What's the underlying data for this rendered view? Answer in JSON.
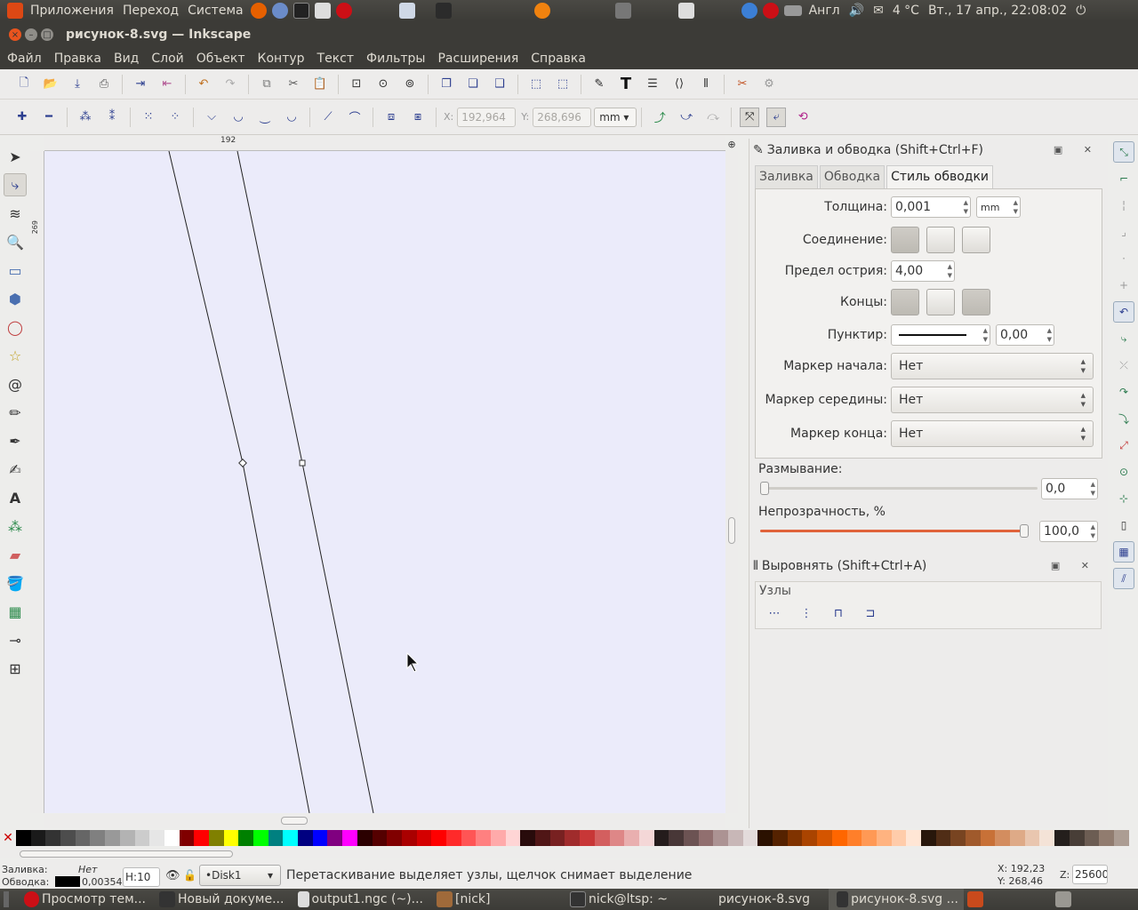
{
  "top_panel": {
    "menus": [
      "Приложения",
      "Переход",
      "Система"
    ],
    "layout": "Англ",
    "weather": "4 °C",
    "datetime": "Вт., 17 апр., 22:08:02"
  },
  "window": {
    "title": "рисунок-8.svg — Inkscape"
  },
  "menubar": [
    "Файл",
    "Правка",
    "Вид",
    "Слой",
    "Объект",
    "Контур",
    "Текст",
    "Фильтры",
    "Расширения",
    "Справка"
  ],
  "node_toolbar": {
    "x_label": "X:",
    "x_value": "192,964",
    "y_label": "Y:",
    "y_value": "268,696",
    "unit": "mm"
  },
  "ruler": {
    "h_label": "192",
    "v_label": "269"
  },
  "fill_stroke": {
    "title": "Заливка и обводка (Shift+Ctrl+F)",
    "tabs": [
      "Заливка",
      "Обводка",
      "Стиль обводки"
    ],
    "width_label": "Толщина:",
    "width_value": "0,001",
    "width_unit": "mm",
    "join_label": "Соединение:",
    "miter_label": "Предел острия:",
    "miter_value": "4,00",
    "cap_label": "Концы:",
    "dash_label": "Пунктир:",
    "dash_offset": "0,00",
    "start_marker_label": "Маркер начала:",
    "start_marker": "Нет",
    "mid_marker_label": "Маркер середины:",
    "mid_marker": "Нет",
    "end_marker_label": "Маркер конца:",
    "end_marker": "Нет",
    "blur_label": "Размывание:",
    "blur_value": "0,0",
    "opacity_label": "Непрозрачность, %",
    "opacity_value": "100,0",
    "blur_level": 0.0,
    "opacity_level": 1.0
  },
  "align": {
    "title": "Выровнять (Shift+Ctrl+A)",
    "section": "Узлы"
  },
  "palette": [
    "#000000",
    "#1a1a1a",
    "#333333",
    "#4d4d4d",
    "#666666",
    "#808080",
    "#999999",
    "#b3b3b3",
    "#cccccc",
    "#e6e6e6",
    "#ffffff",
    "#800000",
    "#ff0000",
    "#808000",
    "#ffff00",
    "#008000",
    "#00ff00",
    "#008080",
    "#00ffff",
    "#000080",
    "#0000ff",
    "#800080",
    "#ff00ff",
    "#2b0000",
    "#550000",
    "#800000",
    "#aa0000",
    "#d40000",
    "#ff0000",
    "#ff2a2a",
    "#ff5555",
    "#ff8080",
    "#ffaaaa",
    "#ffd5d5",
    "#280b0b",
    "#501616",
    "#782121",
    "#a02c2c",
    "#c83737",
    "#d35f5f",
    "#de8787",
    "#e9afaf",
    "#f4d7d7",
    "#241c1c",
    "#483737",
    "#6c5353",
    "#916f6f",
    "#ac9393",
    "#c8b7b7",
    "#e3dbdb",
    "#2b1100",
    "#552200",
    "#803300",
    "#aa4400",
    "#d45500",
    "#ff6600",
    "#ff7f2a",
    "#ff9955",
    "#ffb380",
    "#ffccaa",
    "#ffe6d5",
    "#28170b",
    "#502d16",
    "#784421",
    "#a05a2c",
    "#c87137",
    "#d38d5f",
    "#deaa87",
    "#e9c6af",
    "#f4e3d7",
    "#241f1c",
    "#483e37",
    "#6c5d53",
    "#917c6f",
    "#ac9d93"
  ],
  "status": {
    "fill_label": "Заливка:",
    "fill_value": "Нет",
    "stroke_label": "Обводка:",
    "stroke_width": "0,00354",
    "h_value": "H:10",
    "layer": "•Disk1",
    "message": "Перетаскивание выделяет узлы, щелчок снимает выделение",
    "x": "X: 192,23",
    "y": "Y: 268,46",
    "zoom_label": "Z:",
    "zoom": "25600"
  },
  "taskbar": [
    "Просмотр тем...",
    "Новый докуме...",
    "output1.ngc (~)...",
    "[nick]",
    "nick@ltsp: ~",
    "рисунок-8.svg",
    "рисунок-8.svg ..."
  ]
}
